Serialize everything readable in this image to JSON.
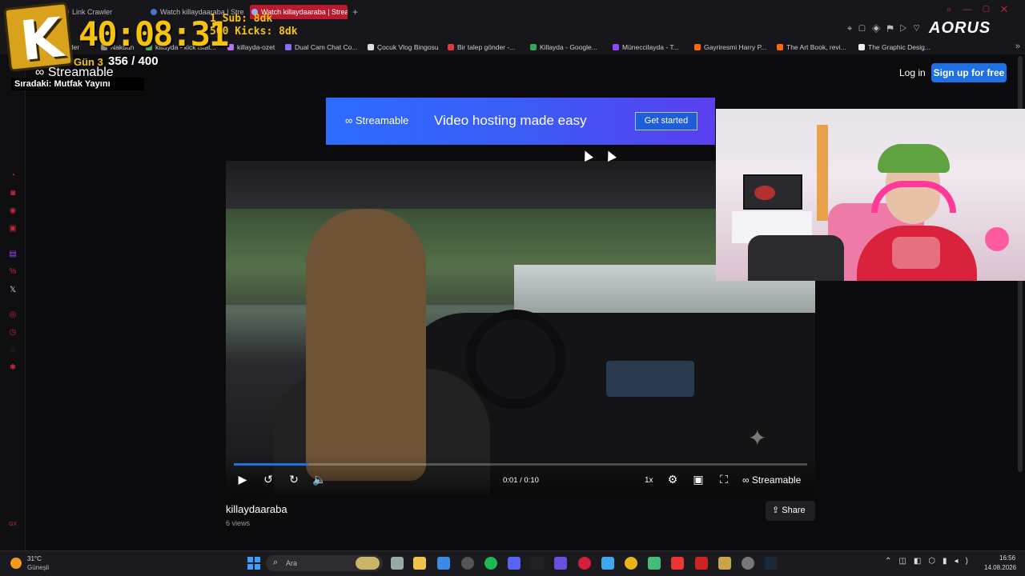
{
  "browser": {
    "tabs": [
      {
        "label": "Link Crawler",
        "active": false
      },
      {
        "label": "Watch killaydaaraba | Strea",
        "active": false
      },
      {
        "label": "Watch killaydaaraba | Strea",
        "active": true
      }
    ],
    "new_tab": "+",
    "brand": "AORUS",
    "bookmarks": [
      {
        "label": "Link Crawler",
        "color": "#c2283a"
      },
      {
        "label": "Nakdun",
        "color": "#888888"
      },
      {
        "label": "killayda - kick istat...",
        "color": "#4caf50"
      },
      {
        "label": "killayda-ozet",
        "color": "#b673f5"
      },
      {
        "label": "Dual Cam Chat Co...",
        "color": "#8f6bff"
      },
      {
        "label": "Çocuk Vlog Bingosu",
        "color": "#dddddd"
      },
      {
        "label": "Bir talep gönder -...",
        "color": "#e33b3b"
      },
      {
        "label": "Killayda - Google...",
        "color": "#34a853"
      },
      {
        "label": "Müneccilayda - T...",
        "color": "#9146ff"
      },
      {
        "label": "Gayriresmi Harry P...",
        "color": "#ff6a00"
      },
      {
        "label": "The Art Book, revi...",
        "color": "#ff6a00"
      },
      {
        "label": "The Graphic Desig...",
        "color": "#eeeeee"
      }
    ]
  },
  "overlay": {
    "logo_letter": "K",
    "timer": "40:08:31",
    "sub_line": "1 Sub: 8dk",
    "kicks_line": "500 Kicks: 8dk",
    "day_label": "Gün 3",
    "day_count": "356 / 400",
    "streamable_label": "Streamable",
    "next_label": "Sıradaki: Mutfak Yayını"
  },
  "header": {
    "login": "Log in",
    "signup": "Sign up for free"
  },
  "banner": {
    "logo": "Streamable",
    "headline": "Video hosting made easy",
    "cta": "Get started"
  },
  "player": {
    "time": "0:01 / 0:10",
    "progress": 0.13,
    "speed": "1x",
    "brand": "Streamable"
  },
  "video": {
    "title": "killaydaaraba",
    "views": "6 views",
    "share": "Share"
  },
  "taskbar": {
    "temperature": "31°C",
    "weather": "Güneşli",
    "search_placeholder": "Ara",
    "time": "16:56",
    "date": "14.08.2026"
  },
  "colors": {
    "accent": "#1f6fe5",
    "overlay_yellow": "#f5c20f",
    "tab_active": "#b81b2d"
  }
}
